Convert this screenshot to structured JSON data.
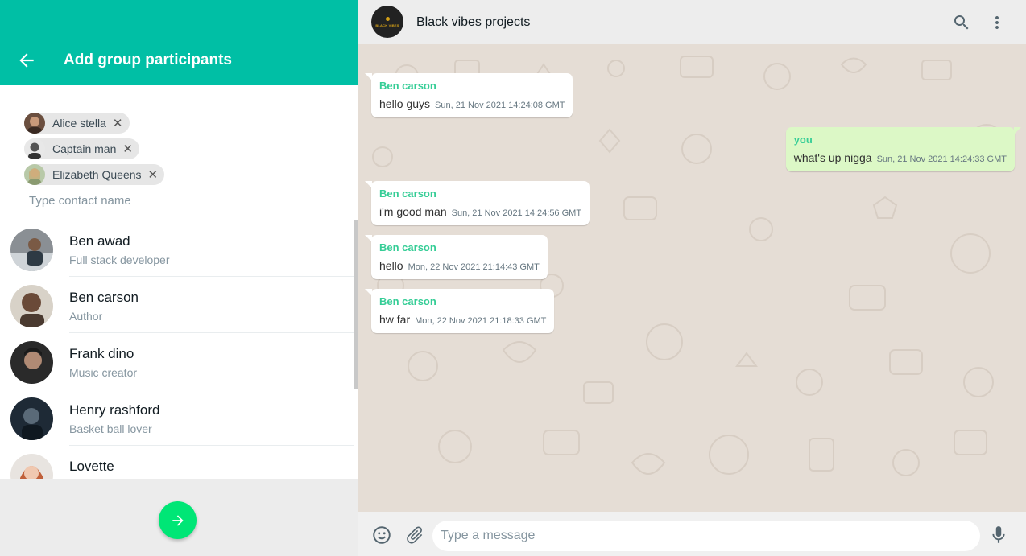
{
  "left_panel": {
    "title": "Add group participants",
    "selected": [
      {
        "name": "Alice stella"
      },
      {
        "name": "Captain man"
      },
      {
        "name": "Elizabeth Queens"
      }
    ],
    "search_placeholder": "Type contact name",
    "contacts": [
      {
        "name": "Ben awad",
        "status": "Full stack developer"
      },
      {
        "name": "Ben carson",
        "status": "Author"
      },
      {
        "name": "Frank dino",
        "status": "Music creator"
      },
      {
        "name": "Henry rashford",
        "status": "Basket ball lover"
      },
      {
        "name": "Lovette",
        "status": ""
      }
    ]
  },
  "chat": {
    "title": "Black vibes projects",
    "avatar_text": "BLACK VIBES",
    "messages": [
      {
        "sender": "Ben carson",
        "text": "hello guys",
        "time": "Sun, 21 Nov 2021 14:24:08 GMT",
        "direction": "in"
      },
      {
        "sender": "you",
        "text": "what's up nigga",
        "time": "Sun, 21 Nov 2021 14:24:33 GMT",
        "direction": "out"
      },
      {
        "sender": "Ben carson",
        "text": "i'm good man",
        "time": "Sun, 21 Nov 2021 14:24:56 GMT",
        "direction": "in"
      },
      {
        "sender": "Ben carson",
        "text": "hello",
        "time": "Mon, 22 Nov 2021 21:14:43 GMT",
        "direction": "in"
      },
      {
        "sender": "Ben carson",
        "text": "hw far",
        "time": "Mon, 22 Nov 2021 21:18:33 GMT",
        "direction": "in"
      }
    ],
    "input_placeholder": "Type a message"
  },
  "colors": {
    "header_teal": "#00bfa5",
    "send_green": "#00e676",
    "sender_name": "#35cd96",
    "outgoing_bubble": "#dcf8c6",
    "chat_bg": "#e5ddd5"
  },
  "icons": {
    "back": "arrow-left-icon",
    "remove_chip": "close-icon",
    "next": "arrow-right-icon",
    "search": "search-icon",
    "menu": "more-vert-icon",
    "emoji": "emoji-icon",
    "attach": "paperclip-icon",
    "mic": "mic-icon"
  }
}
